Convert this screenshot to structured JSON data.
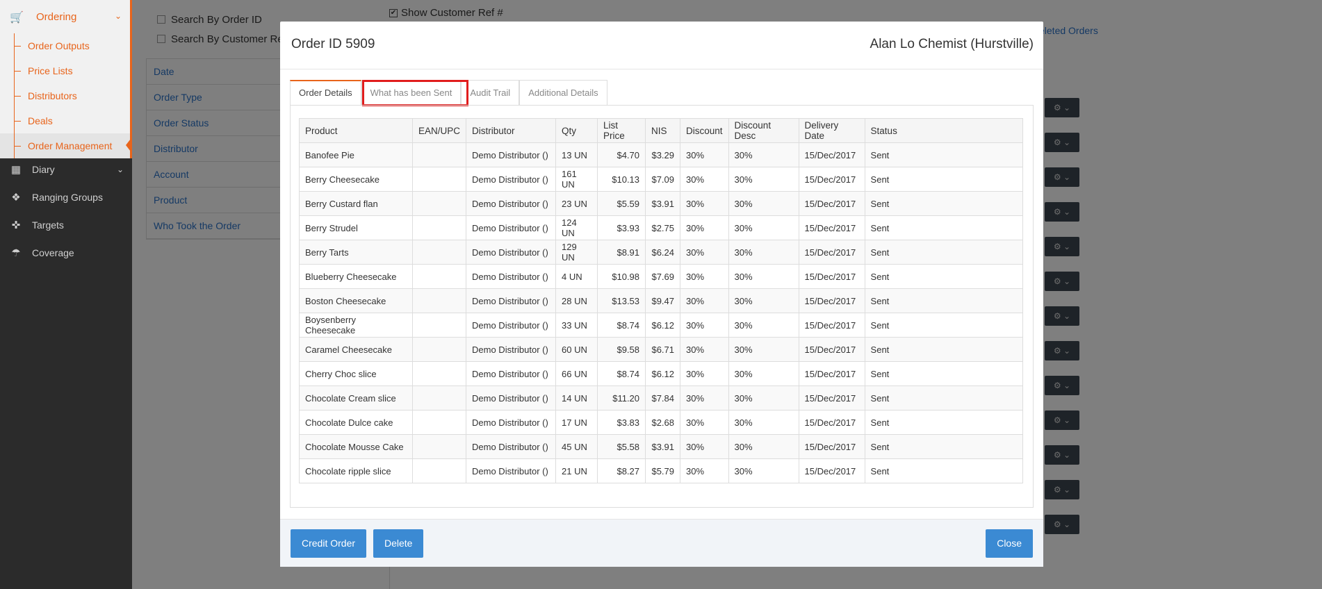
{
  "sidebar": {
    "ordering_label": "Ordering",
    "sub_items": [
      "Order Outputs",
      "Price Lists",
      "Distributors",
      "Deals",
      "Order Management"
    ],
    "main_items": [
      {
        "label": "Diary",
        "icon": "calendar-icon"
      },
      {
        "label": "Ranging Groups",
        "icon": "cubes-icon"
      },
      {
        "label": "Targets",
        "icon": "crosshair-icon"
      },
      {
        "label": "Coverage",
        "icon": "umbrella-icon"
      }
    ]
  },
  "background": {
    "search_by_order_id": "Search By Order ID",
    "search_by_customer_ref": "Search By Customer Refe",
    "show_customer_ref": "Show Customer Ref #",
    "deleted_orders_link": "eleted Orders",
    "filters": [
      "Date",
      "Order Type",
      "Order Status",
      "Distributor",
      "Account",
      "Product",
      "Who Took the Order"
    ]
  },
  "modal": {
    "title": "Order ID 5909",
    "customer": "Alan Lo Chemist (Hurstville)",
    "tabs": [
      "Order Details",
      "What has been Sent",
      "Audit Trail",
      "Additional Details"
    ],
    "active_tab": "Order Details",
    "columns": [
      "Product",
      "EAN/UPC",
      "Distributor",
      "Qty",
      "List Price",
      "NIS",
      "Discount",
      "Discount Desc",
      "Delivery Date",
      "Status"
    ],
    "rows": [
      [
        "Banofee Pie",
        "",
        "Demo Distributor ()",
        "13 UN",
        "$4.70",
        "$3.29",
        "30%",
        "30%",
        "15/Dec/2017",
        "Sent"
      ],
      [
        "Berry Cheesecake",
        "",
        "Demo Distributor ()",
        "161 UN",
        "$10.13",
        "$7.09",
        "30%",
        "30%",
        "15/Dec/2017",
        "Sent"
      ],
      [
        "Berry Custard flan",
        "",
        "Demo Distributor ()",
        "23 UN",
        "$5.59",
        "$3.91",
        "30%",
        "30%",
        "15/Dec/2017",
        "Sent"
      ],
      [
        "Berry Strudel",
        "",
        "Demo Distributor ()",
        "124 UN",
        "$3.93",
        "$2.75",
        "30%",
        "30%",
        "15/Dec/2017",
        "Sent"
      ],
      [
        "Berry Tarts",
        "",
        "Demo Distributor ()",
        "129 UN",
        "$8.91",
        "$6.24",
        "30%",
        "30%",
        "15/Dec/2017",
        "Sent"
      ],
      [
        "Blueberry Cheesecake",
        "",
        "Demo Distributor ()",
        "4 UN",
        "$10.98",
        "$7.69",
        "30%",
        "30%",
        "15/Dec/2017",
        "Sent"
      ],
      [
        "Boston Cheesecake",
        "",
        "Demo Distributor ()",
        "28 UN",
        "$13.53",
        "$9.47",
        "30%",
        "30%",
        "15/Dec/2017",
        "Sent"
      ],
      [
        "Boysenberry Cheesecake",
        "",
        "Demo Distributor ()",
        "33 UN",
        "$8.74",
        "$6.12",
        "30%",
        "30%",
        "15/Dec/2017",
        "Sent"
      ],
      [
        "Caramel Cheesecake",
        "",
        "Demo Distributor ()",
        "60 UN",
        "$9.58",
        "$6.71",
        "30%",
        "30%",
        "15/Dec/2017",
        "Sent"
      ],
      [
        "Cherry Choc slice",
        "",
        "Demo Distributor ()",
        "66 UN",
        "$8.74",
        "$6.12",
        "30%",
        "30%",
        "15/Dec/2017",
        "Sent"
      ],
      [
        "Chocolate Cream slice",
        "",
        "Demo Distributor ()",
        "14 UN",
        "$11.20",
        "$7.84",
        "30%",
        "30%",
        "15/Dec/2017",
        "Sent"
      ],
      [
        "Chocolate Dulce cake",
        "",
        "Demo Distributor ()",
        "17 UN",
        "$3.83",
        "$2.68",
        "30%",
        "30%",
        "15/Dec/2017",
        "Sent"
      ],
      [
        "Chocolate Mousse Cake",
        "",
        "Demo Distributor ()",
        "45 UN",
        "$5.58",
        "$3.91",
        "30%",
        "30%",
        "15/Dec/2017",
        "Sent"
      ],
      [
        "Chocolate ripple slice",
        "",
        "Demo Distributor ()",
        "21 UN",
        "$8.27",
        "$5.79",
        "30%",
        "30%",
        "15/Dec/2017",
        "Sent"
      ]
    ],
    "buttons": {
      "credit": "Credit Order",
      "delete": "Delete",
      "close": "Close"
    }
  },
  "colors": {
    "accent": "#e8641b",
    "button": "#3b8ad3",
    "highlight": "#e11d1d"
  }
}
